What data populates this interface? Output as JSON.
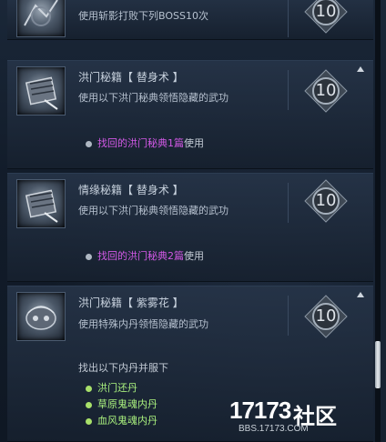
{
  "entries": [
    {
      "title": "",
      "desc": "使用斩影打败下列BOSS10次",
      "medal": "10"
    },
    {
      "title": "洪门秘籍【 替身术 】",
      "desc": "使用以下洪门秘典领悟隐藏的武功",
      "medal": "10",
      "req_highlight": "找回的洪门秘典1篇",
      "req_suffix": "使用"
    },
    {
      "title": "情缘秘籍【 替身术 】",
      "desc": "使用以下洪门秘典领悟隐藏的武功",
      "medal": "10",
      "req_highlight": "找回的洪门秘典2篇",
      "req_suffix": "使用"
    },
    {
      "title": "洪门秘籍【 紫雾花 】",
      "desc": "使用特殊内丹领悟隐藏的武功",
      "medal": "10",
      "sub_heading": "找出以下内丹并服下",
      "items": [
        "洪门还丹",
        "草原鬼魂内丹",
        "血风鬼魂内丹"
      ]
    }
  ],
  "colors": {
    "highlight": "#d259e6",
    "green": "#a9f07e"
  },
  "watermark": {
    "logo_num": "17173",
    "logo_cn": "社区",
    "url": "BBS.17173.COM"
  }
}
